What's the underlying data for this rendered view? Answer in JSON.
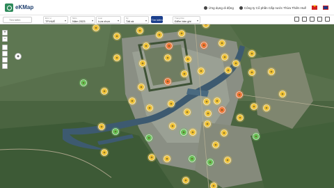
{
  "header": {
    "logo_text": "eKMap",
    "account_link": "Ứng dụng di động",
    "company": "Công ty Cổ phần Cấp nước Thừa Thiên Huế"
  },
  "filters": {
    "search_placeholder": "Tìm kiếm",
    "items": [
      {
        "label": "Đơn vị",
        "value": "TP.HUẾ"
      },
      {
        "label": "Năm",
        "value": "Năm 2023"
      },
      {
        "label": "Loại",
        "value": "Lựa chọn"
      },
      {
        "label": "Kỳ",
        "value": "Tất cả"
      },
      {
        "label": "Trạng thái",
        "value": "Điểm bản ghi"
      }
    ],
    "search_button": "Tìm kiếm"
  },
  "map": {
    "zoom_in": "+",
    "zoom_out": "−",
    "status_colors": {
      "yellow": "#f2c53d",
      "orange": "#f07a3c",
      "green": "#6bc25a"
    },
    "markers": [
      {
        "c": "yellow"
      },
      {
        "c": "yellow"
      },
      {
        "c": "yellow"
      },
      {
        "c": "yellow"
      },
      {
        "c": "yellow"
      },
      {
        "c": "yellow"
      },
      {
        "c": "yellow"
      },
      {
        "c": "orange"
      },
      {
        "c": "orange"
      },
      {
        "c": "yellow"
      },
      {
        "c": "yellow"
      },
      {
        "c": "yellow"
      },
      {
        "c": "yellow"
      },
      {
        "c": "yellow"
      },
      {
        "c": "yellow"
      },
      {
        "c": "yellow"
      },
      {
        "c": "yellow"
      },
      {
        "c": "green"
      },
      {
        "c": "yellow"
      },
      {
        "c": "orange"
      },
      {
        "c": "yellow"
      },
      {
        "c": "yellow"
      },
      {
        "c": "yellow"
      },
      {
        "c": "yellow"
      },
      {
        "c": "yellow"
      },
      {
        "c": "yellow"
      },
      {
        "c": "orange"
      },
      {
        "c": "yellow"
      },
      {
        "c": "yellow"
      },
      {
        "c": "yellow"
      },
      {
        "c": "yellow"
      },
      {
        "c": "yellow"
      },
      {
        "c": "orange"
      },
      {
        "c": "yellow"
      },
      {
        "c": "yellow"
      },
      {
        "c": "yellow"
      },
      {
        "c": "yellow"
      },
      {
        "c": "yellow"
      },
      {
        "c": "yellow"
      },
      {
        "c": "yellow"
      },
      {
        "c": "green"
      },
      {
        "c": "green"
      },
      {
        "c": "yellow"
      },
      {
        "c": "yellow"
      },
      {
        "c": "green"
      },
      {
        "c": "green"
      },
      {
        "c": "yellow"
      },
      {
        "c": "yellow"
      },
      {
        "c": "yellow"
      },
      {
        "c": "green"
      },
      {
        "c": "yellow"
      },
      {
        "c": "green"
      },
      {
        "c": "yellow"
      },
      {
        "c": "yellow"
      },
      {
        "c": "yellow"
      },
      {
        "c": "yellow"
      },
      {
        "c": "yellow"
      }
    ]
  }
}
